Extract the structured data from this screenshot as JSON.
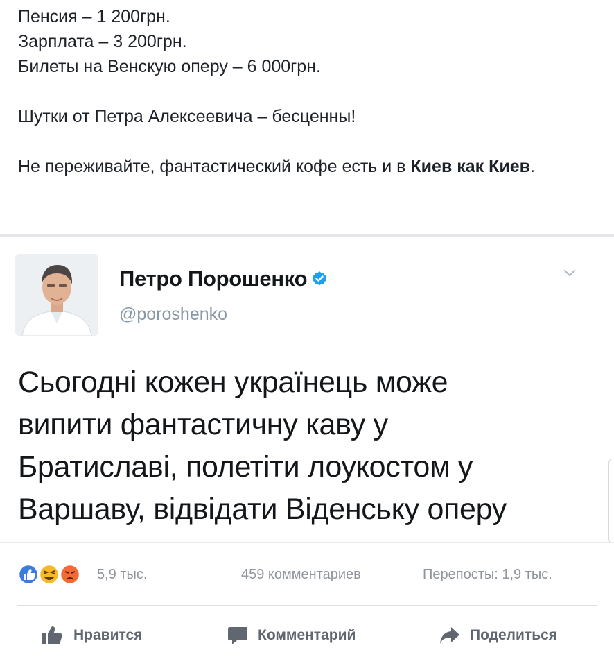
{
  "post": {
    "line1": "Пенсия – 1 200грн.",
    "line2": "Зарплата – 3 200грн.",
    "line3": "Билеты на Венскую оперу – 6 000грн.",
    "line4": "Шутки от Петра Алексеевича – бесценны!",
    "line5_prefix": "Не переживайте, фантастический кофе есть и в ",
    "line5_link": "Киев как Киев",
    "line5_suffix": "."
  },
  "tweet": {
    "name": "Петро Порошенко",
    "handle": "@poroshenko",
    "body": [
      "Сьогодні кожен українець може",
      "випити фантастичну каву у",
      "Братиславі, полетіти лоукостом у",
      "Варшаву, відвідати Віденську оперу"
    ]
  },
  "reactions": {
    "icons": [
      "like-icon",
      "haha-icon",
      "angry-icon"
    ],
    "count": "5,9 тыс.",
    "comments": "459 комментариев",
    "shares": "Перепосты: 1,9 тыс."
  },
  "actions": {
    "like": "Нравится",
    "comment": "Комментарий",
    "share": "Поделиться"
  },
  "colors": {
    "text": "#1d2129",
    "muted": "#90949c",
    "action": "#606770",
    "verified": "#1da1f2",
    "like_blue": "#3b5998",
    "haha_yellow": "#f7b928",
    "angry_red": "#e9710f"
  }
}
